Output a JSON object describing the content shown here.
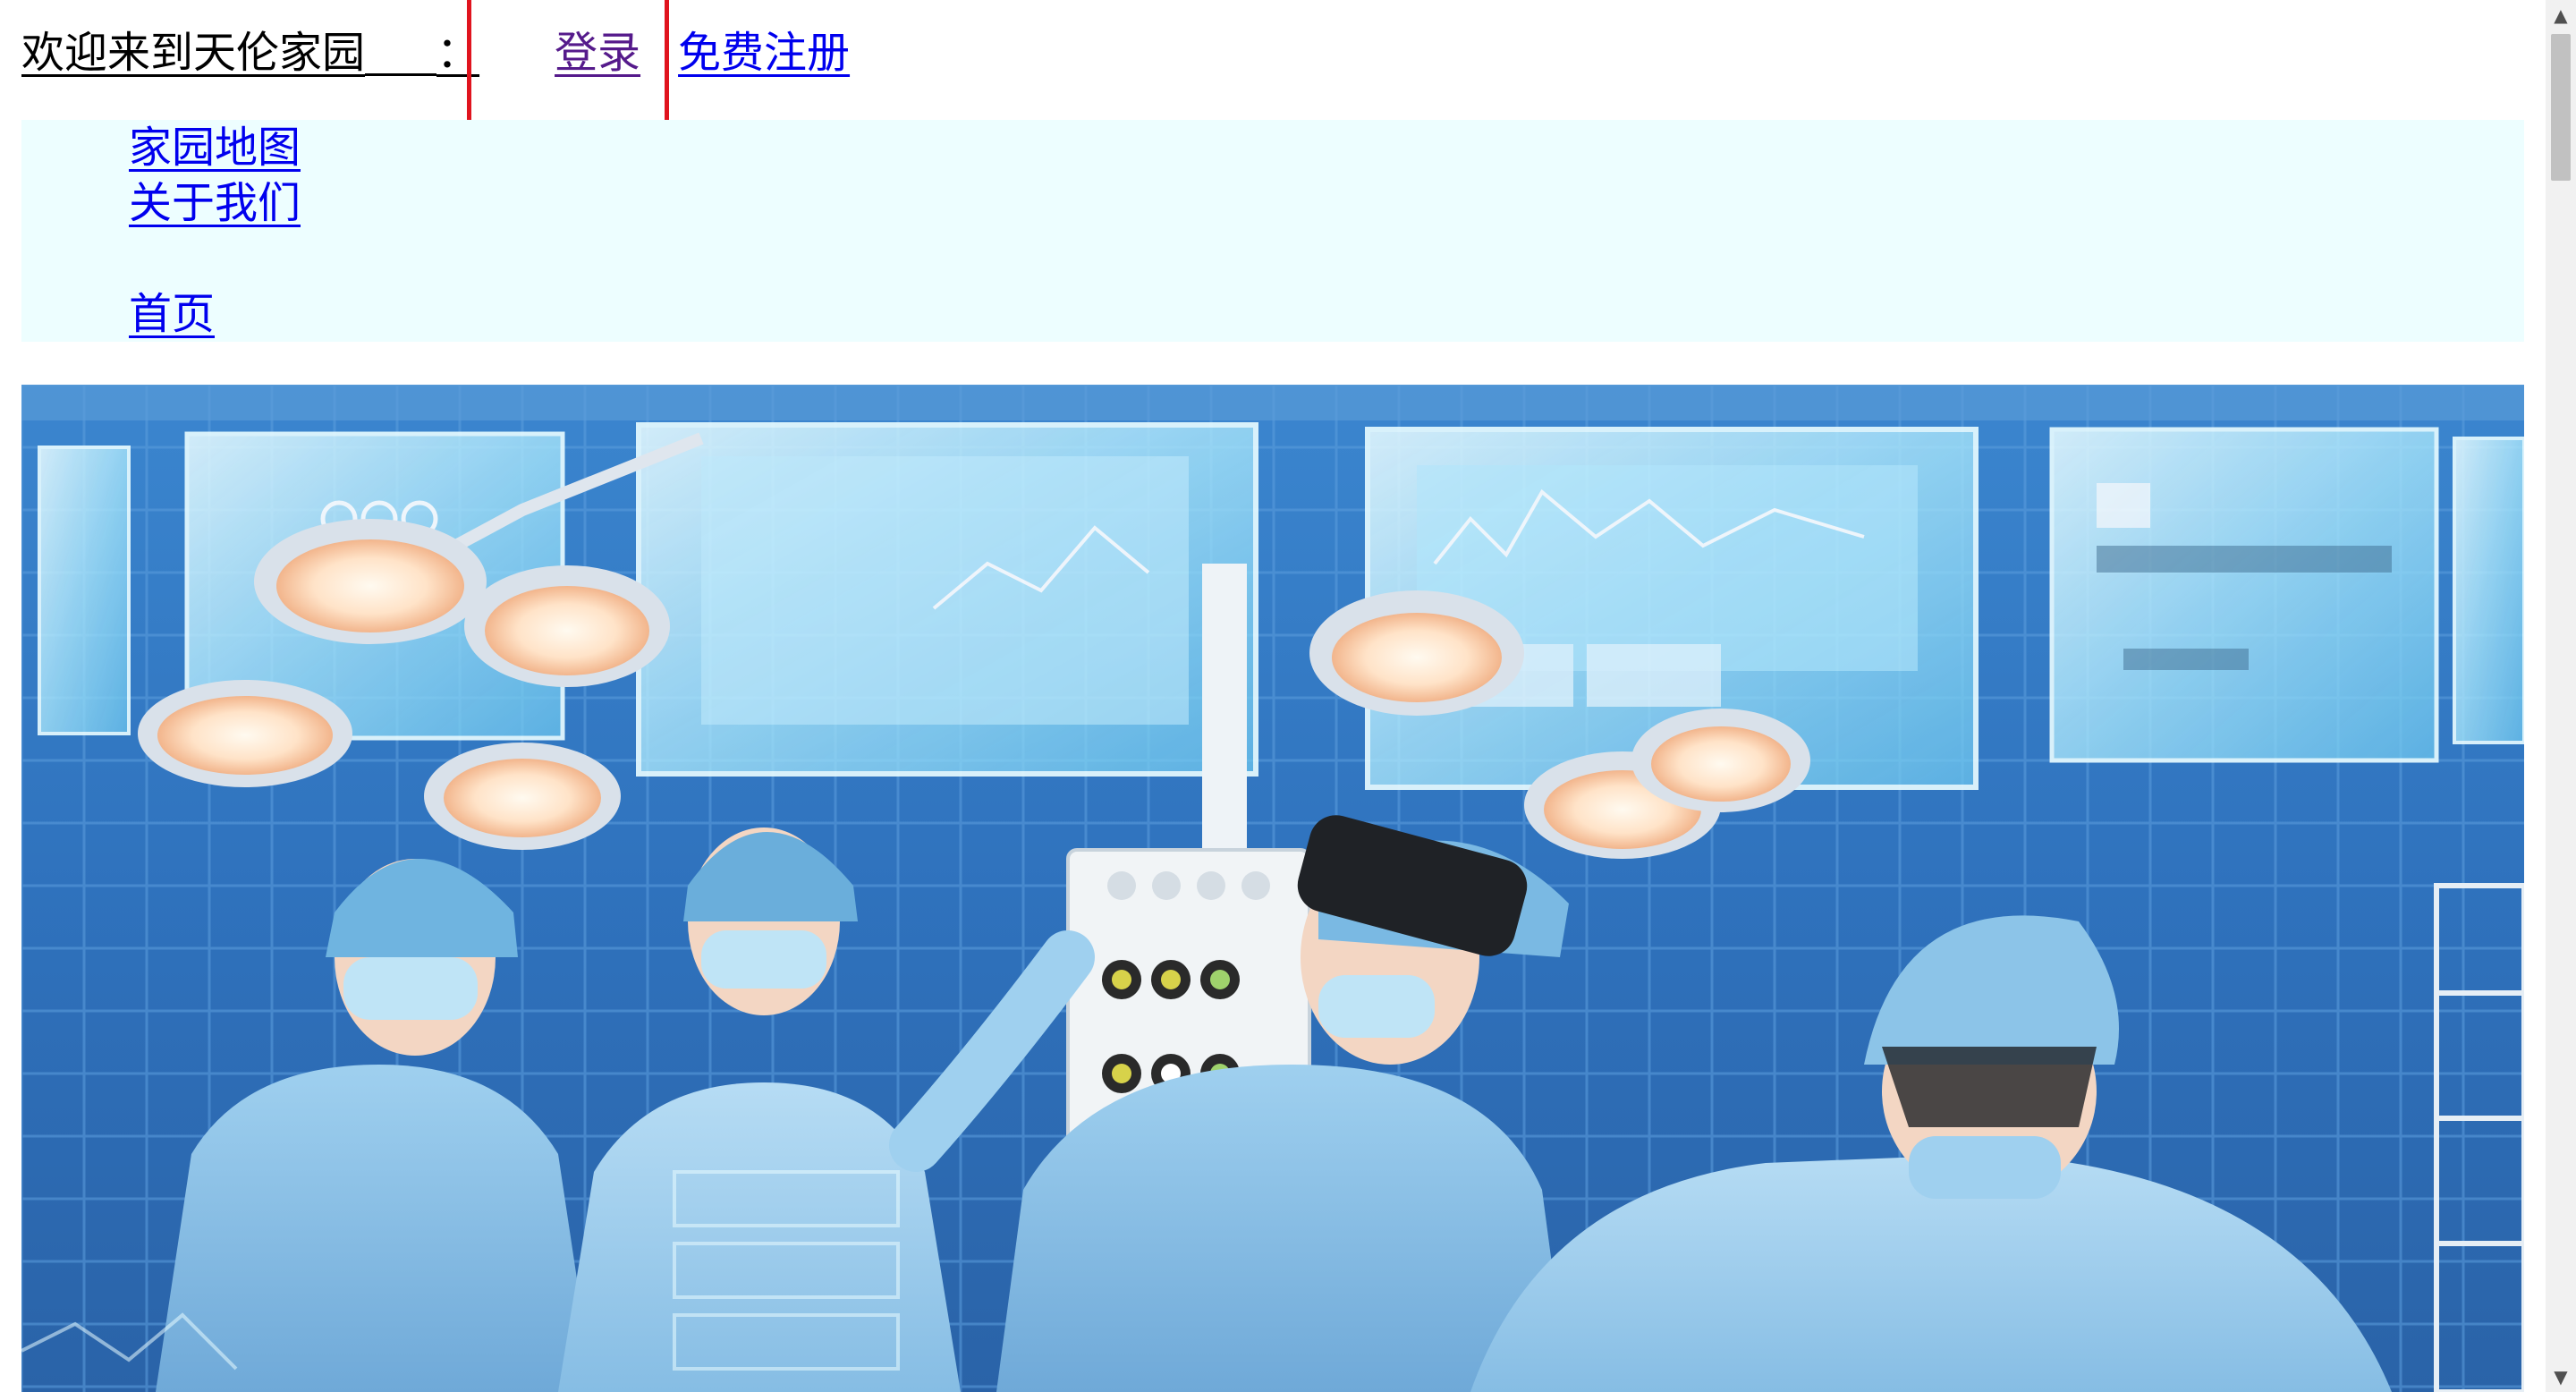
{
  "header": {
    "welcome_text": "欢迎来到天伦家园",
    "colon": "：",
    "login_label": "登录",
    "register_label": "免费注册"
  },
  "nav": {
    "items": [
      {
        "label": "家园地图"
      },
      {
        "label": "关于我们"
      },
      {
        "label": "首页"
      }
    ]
  },
  "hero": {
    "image_alt": ""
  },
  "colors": {
    "link": "#0000ee",
    "visited_link": "#551a8b",
    "nav_background": "#edfeff",
    "highlight_box": "#e0141e"
  },
  "scrollbar": {
    "up_icon": "triangle-up-icon",
    "down_icon": "triangle-down-icon"
  }
}
